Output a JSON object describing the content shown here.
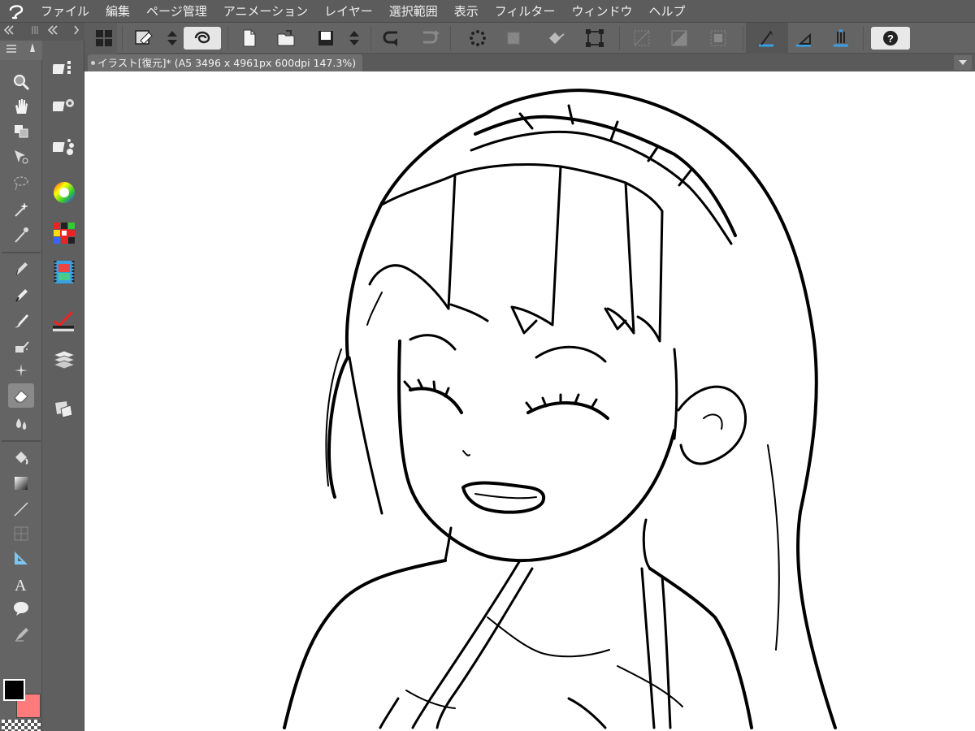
{
  "menu": [
    "ファイル",
    "編集",
    "ページ管理",
    "アニメーション",
    "レイヤー",
    "選択範囲",
    "表示",
    "フィルター",
    "ウィンドウ",
    "ヘルプ"
  ],
  "document": {
    "tab_title": "イラスト[復元]* (A5 3496 x 4961px 600dpi 147.3%)"
  },
  "colors": {
    "main": "#000000",
    "sub": "#ff7a7a"
  },
  "tools": [
    "zoom-icon",
    "hand-icon",
    "rotate-icon",
    "object-select-icon",
    "lasso-icon",
    "magic-wand-icon",
    "eyedropper-icon",
    "pen-icon",
    "pencil-icon",
    "brush-icon",
    "airbrush-icon",
    "decoration-icon",
    "eraser-icon",
    "blend-icon",
    "fill-icon",
    "gradient-icon",
    "line-icon",
    "frame-icon",
    "ruler-icon",
    "text-icon",
    "balloon-icon",
    "correction-icon"
  ],
  "panels": [
    "sub-tool-icon",
    "tool-property-icon",
    "brush-size-icon",
    "color-wheel-icon",
    "color-set-icon",
    "animation-timeline-icon",
    "layer-property-icon",
    "layer-icon",
    "material-icon"
  ],
  "toolbar": {
    "help_label": "?"
  }
}
